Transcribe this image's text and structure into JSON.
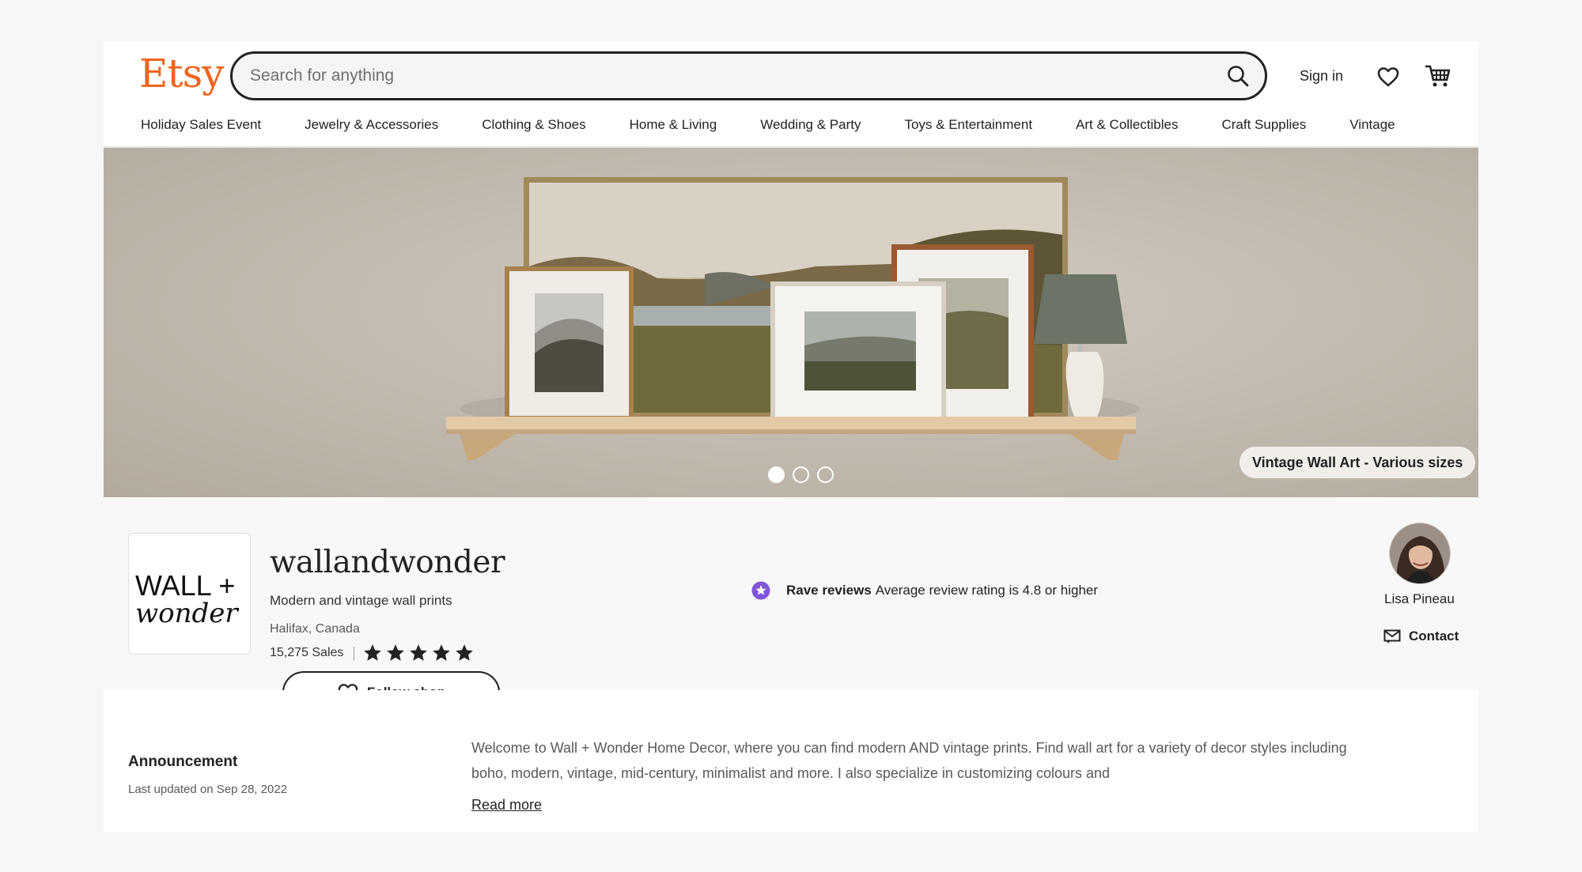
{
  "header": {
    "logo": "Etsy",
    "search_placeholder": "Search for anything",
    "sign_in": "Sign in"
  },
  "nav": [
    "Holiday Sales Event",
    "Jewelry & Accessories",
    "Clothing & Shoes",
    "Home & Living",
    "Wedding & Party",
    "Toys & Entertainment",
    "Art & Collectibles",
    "Craft Supplies",
    "Vintage"
  ],
  "banner": {
    "caption": "Vintage Wall Art - Various sizes",
    "slides": 3,
    "active_slide": 1
  },
  "shop": {
    "logo_line1": "WALL +",
    "logo_line2": "wonder",
    "name": "wallandwonder",
    "tagline": "Modern and vintage wall prints",
    "location": "Halifax, Canada",
    "sales": "15,275 Sales",
    "rating_stars": 5,
    "follow_label": "Follow shop",
    "rave_title": "Rave reviews",
    "rave_text": "Average review rating is 4.8 or higher",
    "owner_name": "Lisa Pineau",
    "contact_label": "Contact"
  },
  "announcement": {
    "title": "Announcement",
    "updated": "Last updated on Sep 28, 2022",
    "text": "Welcome to Wall + Wonder Home Decor, where you can find modern AND vintage prints. Find wall art for a variety of decor styles including boho, modern, vintage, mid-century, minimalist and more. I also specialize in customizing colours and",
    "read_more": "Read more"
  },
  "colors": {
    "brand": "#f1641e",
    "rave_badge": "#7f56d9"
  }
}
